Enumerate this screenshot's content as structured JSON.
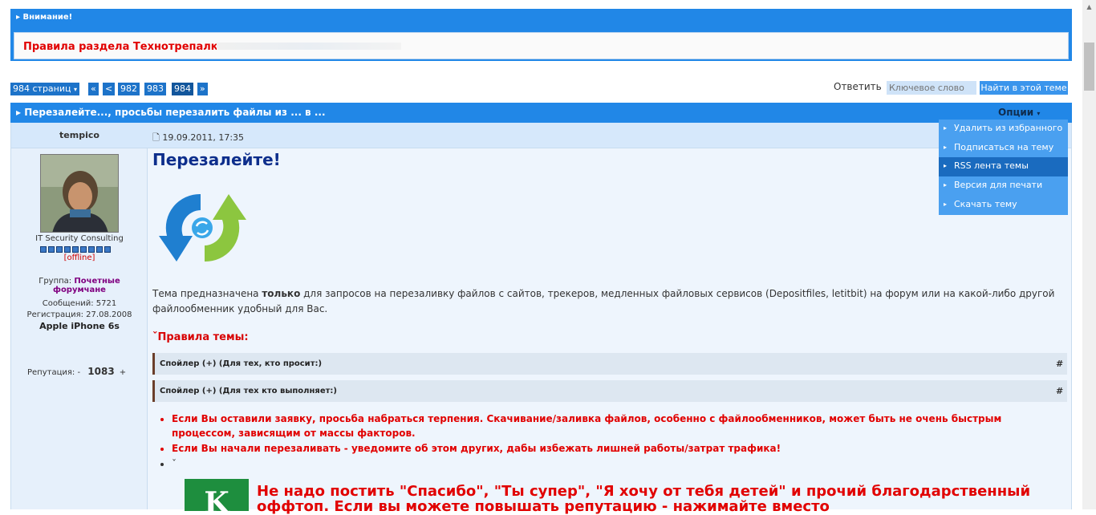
{
  "notice": {
    "heading": "Внимание!",
    "text": "Правила раздела Технотрепалка."
  },
  "pagination": {
    "pages_dropdown": "984 страниц",
    "first": "«",
    "prev": "<",
    "pages": [
      "982",
      "983",
      "984"
    ],
    "current": "984",
    "next": "»"
  },
  "toolbar": {
    "reply_label": "Ответить",
    "search_placeholder": "Ключевое слово",
    "search_button": "Найти в этой теме"
  },
  "thread": {
    "title": "Перезалейте..., просьбы перезалить файлы из ... в ...",
    "options_label": "Опции",
    "options_menu": [
      "Удалить из избранного",
      "Подписаться на тему",
      "RSS лента темы",
      "Версия для печати",
      "Скачать тему"
    ],
    "options_active_index": 2
  },
  "post": {
    "author": "tempico",
    "date": "19.09.2011, 17:35",
    "author_title": "IT Security Consulting",
    "status": "[offline]",
    "group_label": "Группа:",
    "group": "Почетные форумчане",
    "posts_label": "Сообщений:",
    "posts": "5721",
    "registered_label": "Регистрация:",
    "registered": "27.08.2008",
    "device": "Apple iPhone 6s",
    "reputation_label": "Репутация:",
    "reputation_minus": "-",
    "reputation_value": "1083",
    "reputation_plus": "+",
    "heading": "Перезалейте!",
    "intro_pre": "Тема предназначена ",
    "intro_bold": "только",
    "intro_post": " для запросов на перезаливку файлов с сайтов, трекеров, медленных файловых сервисов (Depositfiles, letitbit) на форум или на какой-либо другой файлообменник удобный для Вас.",
    "rules_heading": "ˇПравила темы:",
    "spoilers": [
      "Спойлер (+) (Для тех, кто просит:)",
      "Спойлер (+) (Для тех кто выполняет:)"
    ],
    "spoiler_hash": "#",
    "bullets": [
      "Если Вы оставили заявку, просьба набраться терпения. Скачивание/заливка файлов, особенно с файлообменников, может быть не очень быстрым процессом, зависящим от массы факторов.",
      "Если Вы начали перезаливать - уведомите об этом других, дабы избежать лишней работы/затрат трафика!",
      "ˇ"
    ],
    "k_letter": "K",
    "big_notice": "Не надо постить \"Спасибо\", \"Ты супер\", \"Я хочу от тебя детей\" и прочий благодарственный оффтоп. Если вы можете повышать репутацию - нажимайте вместо"
  },
  "colors": {
    "bar_blue": "#2187e7",
    "red_text": "#e10000",
    "heading_blue": "#0d2e8c"
  }
}
